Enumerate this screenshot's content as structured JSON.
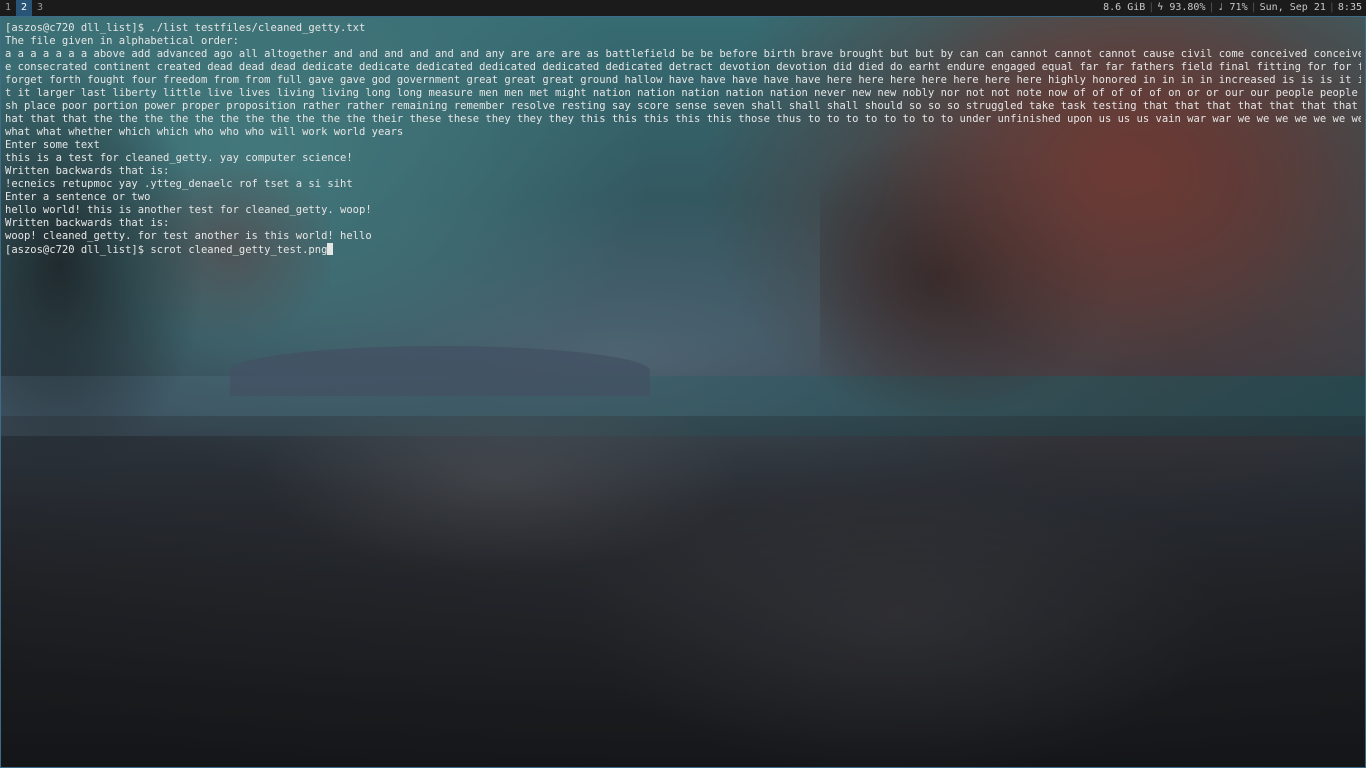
{
  "topbar": {
    "workspaces": [
      "1",
      "2",
      "3"
    ],
    "active_workspace": "2",
    "status": {
      "memory": "8.6 GiB",
      "battery": "ϟ 93.80%",
      "volume": "♩ 71%",
      "date": "Sun, Sep 21",
      "time": "8:35"
    }
  },
  "terminal": {
    "lines": [
      "[aszos@c720 dll_list]$ ./list testfiles/cleaned_getty.txt",
      "The file given in alphabetical order:",
      "a a a a a a a above add advanced ago all altogether and and and and and and any are are are as battlefield be be before birth brave brought but but by can can cannot cannot cannot cause civil come conceived conceived consecrat",
      "e consecrated continent created dead dead dead dedicate dedicate dedicated dedicated dedicated dedicated detract devotion devotion did died do earht endure engaged equal far far fathers field final fitting for for for for",
      "forget forth fought four freedom from from full gave gave god government great great great ground hallow have have have have have here here here here here here here highly honored in in in in increased is is is it it it i",
      "t it larger last liberty little live lives living living long long measure men men met might nation nation nation nation nation never new new nobly nor not not note now of of of of of on or or our our people people people peri",
      "sh place poor portion power proper proposition rather rather remaining remember resolve resting say score sense seven shall shall shall should so so so struggled take task testing that that that that that that that that t",
      "hat that that the the the the the the the the the the the their these these they they they this this this this this those thus to to to to to to to to under unfinished upon us us us vain war war we we we we we we we we we",
      "what what whether which which who who who will work world years",
      "Enter some text",
      "this is a test for cleaned_getty. yay computer science!",
      "Written backwards that is:",
      "!ecneics retupmoc yay .ytteg_denaelc rof tset a si siht",
      "Enter a sentence or two",
      "hello world! this is another test for cleaned_getty. woop!",
      "Written backwards that is:",
      "woop! cleaned_getty. for test another is this world! hello",
      "[aszos@c720 dll_list]$ scrot cleaned_getty_test.png"
    ]
  }
}
